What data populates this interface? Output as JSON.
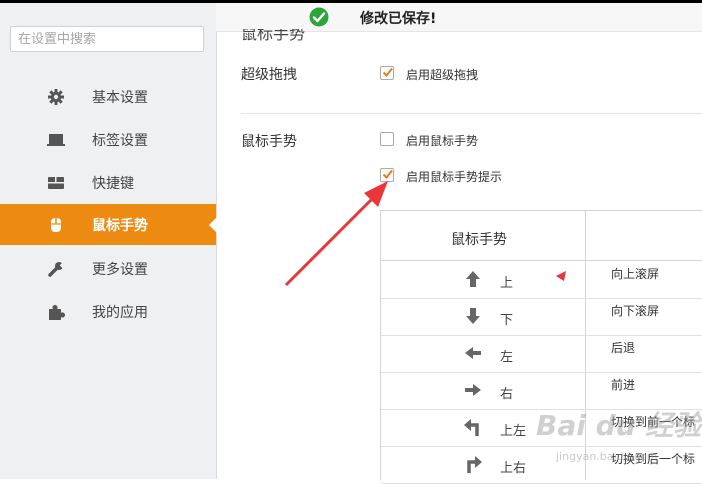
{
  "sidebar": {
    "search_placeholder": "在设置中搜索",
    "items": [
      {
        "label": "基本设置",
        "icon": "gear-icon"
      },
      {
        "label": "标签设置",
        "icon": "tab-icon"
      },
      {
        "label": "快捷键",
        "icon": "keyboard-icon"
      },
      {
        "label": "鼠标手势",
        "icon": "mouse-icon",
        "active": true
      },
      {
        "label": "更多设置",
        "icon": "wrench-icon"
      },
      {
        "label": "我的应用",
        "icon": "puzzle-icon"
      }
    ]
  },
  "toast": {
    "message": "修改已保存!",
    "icon": "check-circle-icon"
  },
  "main": {
    "ghost_title": "鼠标手势",
    "super_drag": {
      "title": "超级拖拽",
      "option_label": "启用超级拖拽",
      "checked": true
    },
    "mouse_gesture": {
      "title": "鼠标手势",
      "options": [
        {
          "label": "启用鼠标手势",
          "checked": false
        },
        {
          "label": "启用鼠标手势提示",
          "checked": true
        }
      ]
    },
    "table": {
      "header": "鼠标手势",
      "rows": [
        {
          "direction": "上",
          "action": "向上滚屏",
          "icon": "arrow-up-icon"
        },
        {
          "direction": "下",
          "action": "向下滚屏",
          "icon": "arrow-down-icon"
        },
        {
          "direction": "左",
          "action": "后退",
          "icon": "arrow-left-icon"
        },
        {
          "direction": "右",
          "action": "前进",
          "icon": "arrow-right-icon"
        },
        {
          "direction": "上左",
          "action": "切换到前一个标",
          "icon": "arrow-up-left-icon"
        },
        {
          "direction": "上右",
          "action": "切换到后一个标",
          "icon": "arrow-up-right-icon"
        }
      ]
    }
  },
  "watermark": {
    "text": "Bai du 经验",
    "sub": "jingyan.baidu.com"
  },
  "colors": {
    "accent": "#ec8a12",
    "check": "#e87a1c",
    "annotation": "#e8363a",
    "toast_icon": "#2ea53a"
  }
}
